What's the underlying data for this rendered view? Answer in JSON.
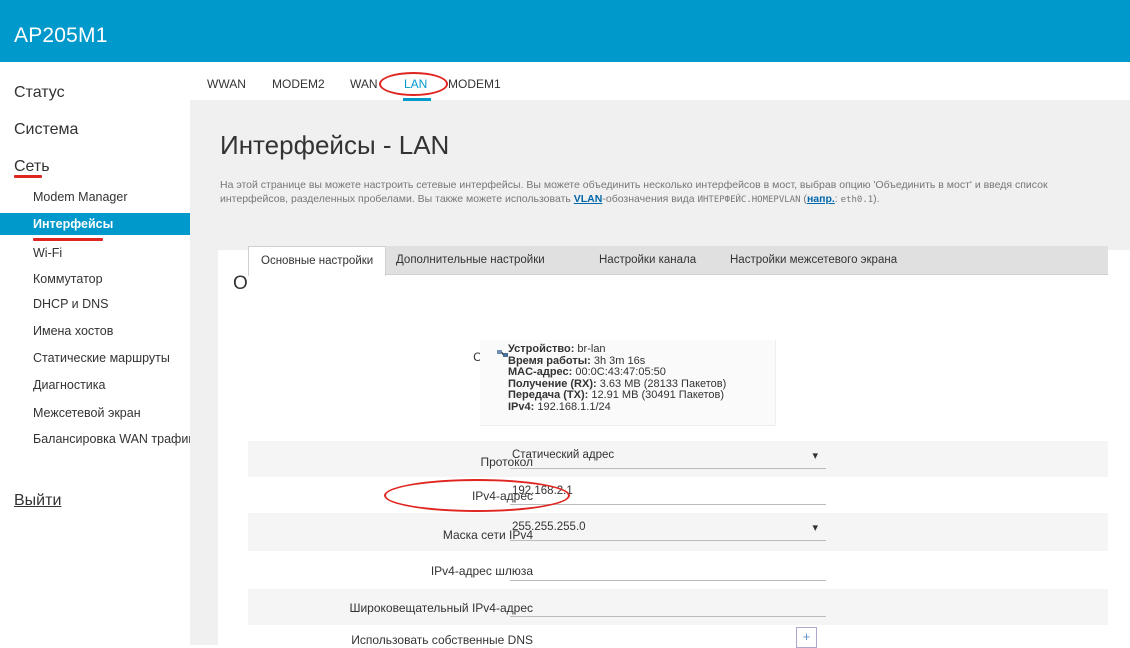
{
  "app": {
    "title": "AP205M1"
  },
  "sidebar": {
    "status": "Статус",
    "system": "Система",
    "network": "Сеть",
    "items": [
      "Modem Manager",
      "Интерфейсы",
      "Wi-Fi",
      "Коммутатор",
      "DHCP и DNS",
      "Имена хостов",
      "Статические маршруты",
      "Диагностика",
      "Межсетевой экран",
      "Балансировка WAN трафик"
    ],
    "logout": "Выйти"
  },
  "tabs": [
    "WWAN",
    "MODEM2",
    "WAN",
    "LAN",
    "MODEM1"
  ],
  "page": {
    "title": "Интерфейсы - LAN",
    "desc_1": "На этой странице вы можете настроить сетевые интерфейсы. Вы можете объединить несколько интерфейсов в мост, выбрав опцию 'Объединить в мост' и введя список интерфейсов, разделенных пробелами. Вы также можете использовать ",
    "desc_link": "VLAN",
    "desc_2": "-обозначения вида ",
    "desc_code": "ИНТЕРФЕЙС.НОМЕРVLAN",
    "desc_3": " (",
    "desc_example_link": "напр.",
    "desc_4": ": ",
    "desc_example_code": "eth0.1",
    "desc_5": ")."
  },
  "section": {
    "title": "Общие настройки",
    "subtabs": [
      "Основные настройки",
      "Дополнительные настройки",
      "Настройки канала",
      "Настройки межсетевого экрана"
    ]
  },
  "form": {
    "status_label": "Состояние",
    "status": {
      "device_k": "Устройство:",
      "device_v": " br-lan",
      "uptime_k": "Время работы:",
      "uptime_v": " 3h 3m 16s",
      "mac_k": "MAC-адрес:",
      "mac_v": " 00:0C:43:47:05:50",
      "rx_k": "Получение (RX):",
      "rx_v": " 3.63 MB (28133 Пакетов)",
      "tx_k": "Передача (TX):",
      "tx_v": " 12.91 MB (30491 Пакетов)",
      "ipv4_k": "IPv4:",
      "ipv4_v": " 192.168.1.1/24"
    },
    "protocol_label": "Протокол",
    "protocol_value": "Статический адрес",
    "ipv4_label": "IPv4-адрес",
    "ipv4_value": "192.168.2.1",
    "netmask_label": "Маска сети IPv4",
    "netmask_value": "255.255.255.0",
    "gateway_label": "IPv4-адрес шлюза",
    "gateway_value": "",
    "broadcast_label": "Широковещательный IPv4-адрес",
    "broadcast_value": "",
    "dns_label": "Использовать собственные DNS",
    "dns_add": "+"
  },
  "colors": {
    "accent": "#0099cc",
    "highlight": "#e0241f"
  }
}
